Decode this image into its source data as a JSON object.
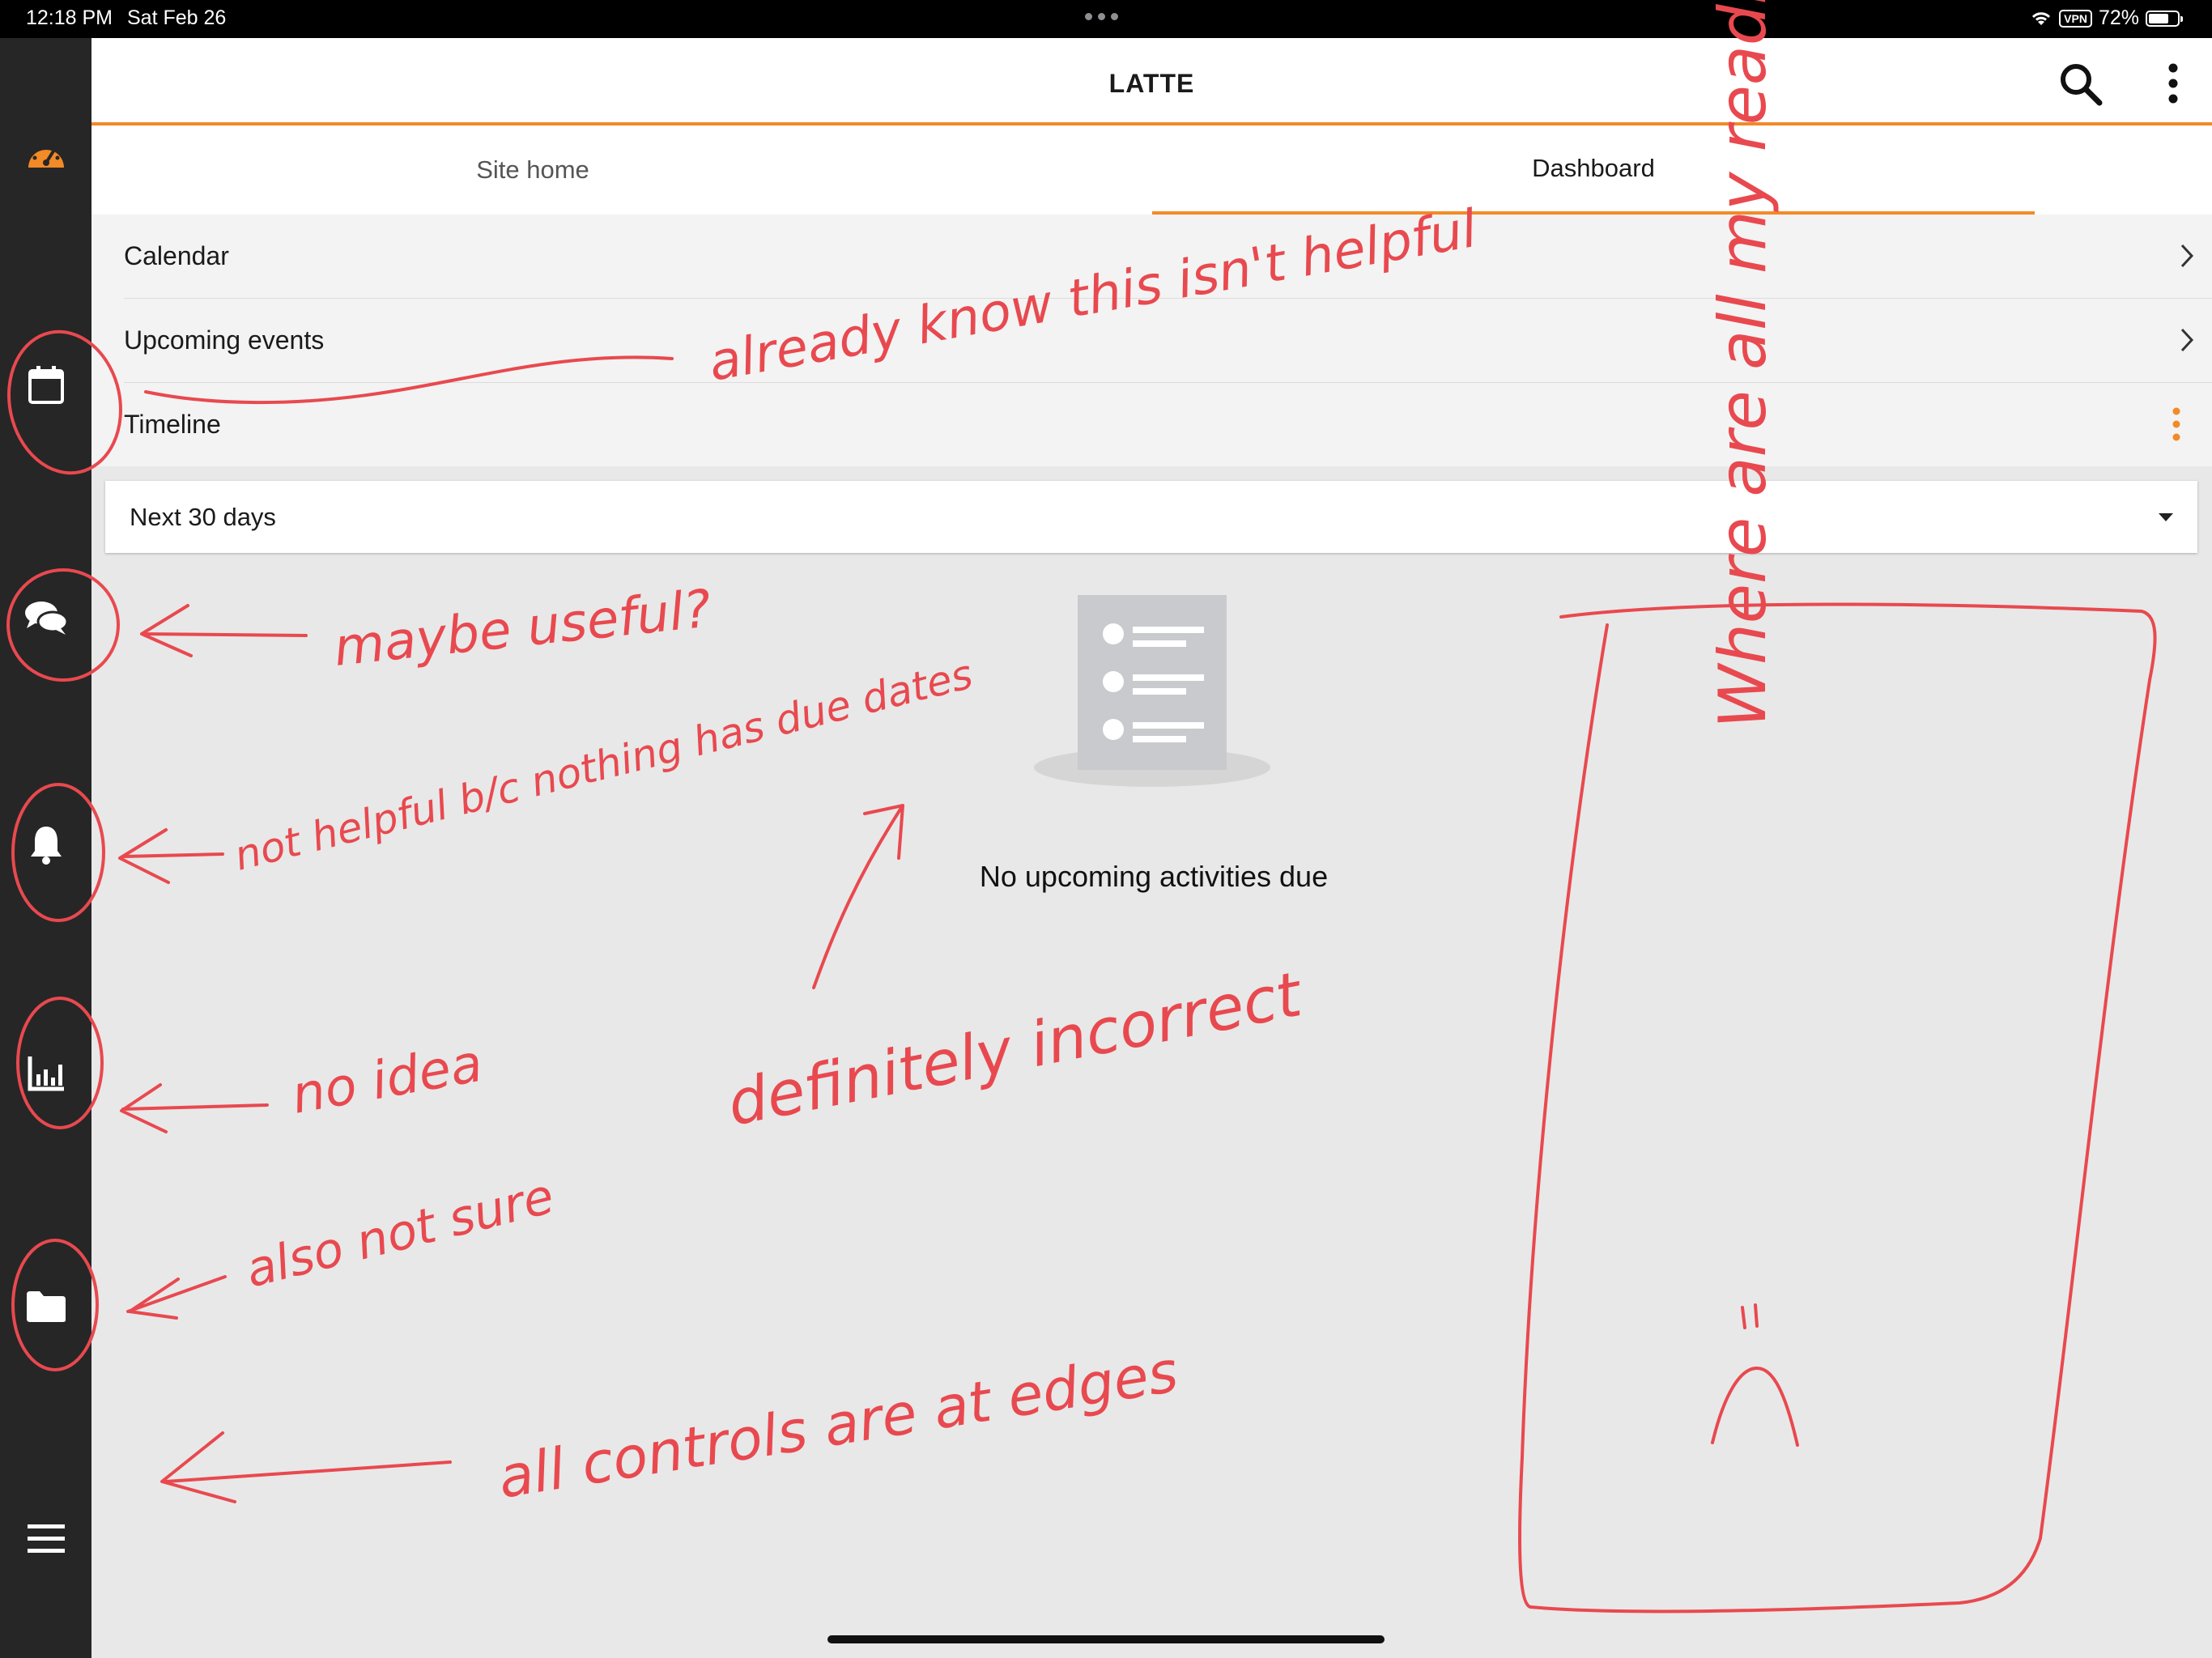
{
  "status_bar": {
    "time": "12:18 PM",
    "date": "Sat Feb 26",
    "vpn": "VPN",
    "battery": "72%"
  },
  "app": {
    "title": "LATTE"
  },
  "sidebar": {
    "items": [
      {
        "icon": "dashboard-gauge-icon"
      },
      {
        "icon": "calendar-icon"
      },
      {
        "icon": "chat-bubbles-icon"
      },
      {
        "icon": "bell-icon"
      },
      {
        "icon": "bar-chart-icon"
      },
      {
        "icon": "folder-icon"
      },
      {
        "icon": "hamburger-menu-icon"
      }
    ]
  },
  "tabs": [
    {
      "label": "Site home",
      "active": false
    },
    {
      "label": "Dashboard",
      "active": true
    }
  ],
  "blocks": [
    {
      "label": "Calendar"
    },
    {
      "label": "Upcoming events"
    },
    {
      "label": "Timeline"
    }
  ],
  "timeline_filter": {
    "selected": "Next 30 days"
  },
  "empty_state": {
    "message": "No upcoming activities due"
  },
  "colors": {
    "accent": "#f28a27",
    "sidebar": "#262626",
    "annotation": "#e8494f"
  },
  "annotations": [
    "already know this isn't helpful",
    "maybe useful?",
    "not helpful b/c nothing has due dates",
    "no idea",
    "also not sure",
    "all controls are at edges",
    "definitely incorrect",
    "Where are all my readings? :("
  ]
}
